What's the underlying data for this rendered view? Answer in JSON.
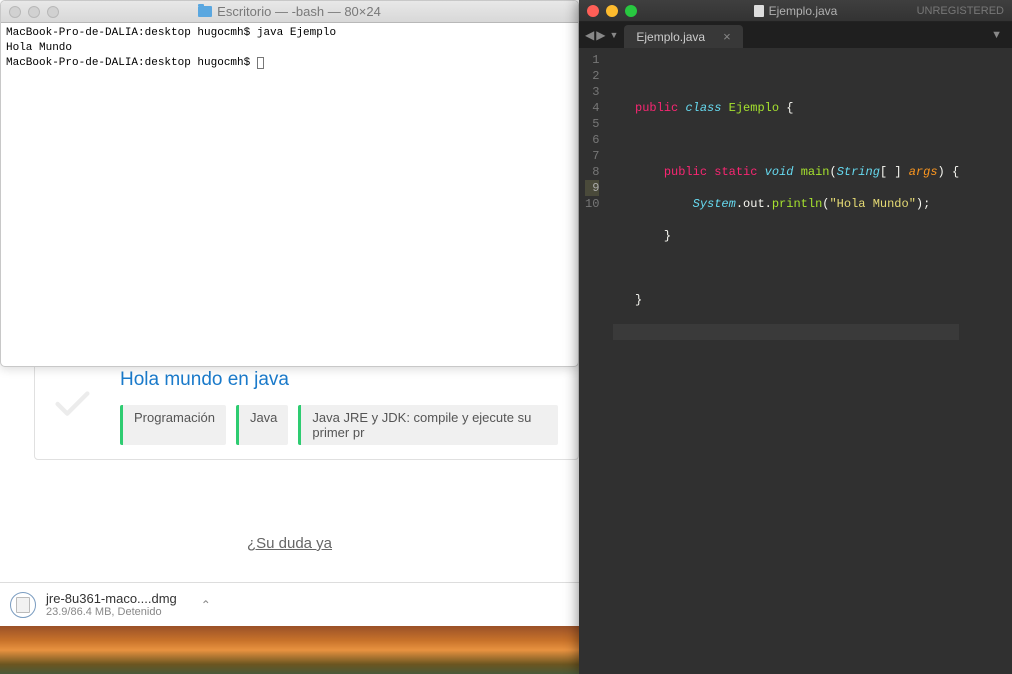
{
  "terminal": {
    "title": "Escritorio — -bash — 80×24",
    "lines": [
      "MacBook-Pro-de-DALIA:desktop hugocmh$ java Ejemplo",
      "Hola Mundo",
      "MacBook-Pro-de-DALIA:desktop hugocmh$ "
    ]
  },
  "page": {
    "card_title": "Hola mundo en java",
    "tags": [
      "Programación",
      "Java",
      "Java JRE y JDK: compile y ejecute su primer pr"
    ],
    "faq_text": "¿Su duda ya "
  },
  "download": {
    "name": "jre-8u361-maco....dmg",
    "status": "23.9/86.4 MB, Detenido"
  },
  "sublime": {
    "title_file": "Ejemplo.java",
    "unregistered": "UNREGISTERED",
    "tab_label": "Ejemplo.java",
    "line_numbers": [
      "1",
      "2",
      "3",
      "4",
      "5",
      "6",
      "7",
      "8",
      "9",
      "10"
    ],
    "code": {
      "l2": {
        "public": "public",
        "class": "class",
        "name": "Ejemplo",
        "brace": "{"
      },
      "l4": {
        "public": "public",
        "static": "static",
        "void": "void",
        "main": "main",
        "lparen": "(",
        "string": "String",
        "brackets": "[ ]",
        "args": "args",
        "rparen": ")",
        "brace": "{"
      },
      "l5": {
        "system": "System",
        "dot1": ".",
        "out": "out",
        "dot2": ".",
        "println": "println",
        "lparen": "(",
        "str": "\"Hola Mundo\"",
        "rparen": ")",
        "semi": ";"
      },
      "l6": {
        "brace": "}"
      },
      "l8": {
        "brace": "}"
      }
    }
  }
}
